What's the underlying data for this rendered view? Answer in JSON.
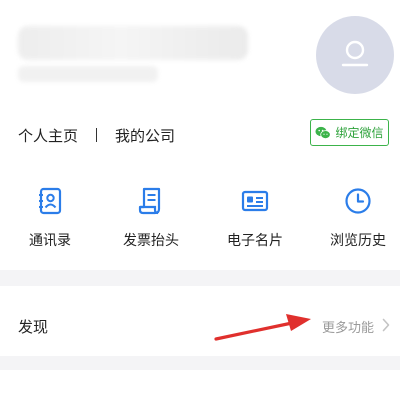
{
  "profile": {
    "links": {
      "home": "个人主页",
      "company": "我的公司"
    },
    "wechat_button": "绑定微信"
  },
  "quick_actions": [
    {
      "label": "通讯录",
      "icon": "contacts-icon"
    },
    {
      "label": "发票抬头",
      "icon": "invoice-icon"
    },
    {
      "label": "电子名片",
      "icon": "business-card-icon"
    },
    {
      "label": "浏览历史",
      "icon": "history-clock-icon"
    }
  ],
  "discover": {
    "title": "发现",
    "more_label": "更多功能"
  },
  "colors": {
    "accent_blue": "#2b7de9",
    "wechat_green": "#3cb34a",
    "annotation_red": "#e0302d"
  }
}
